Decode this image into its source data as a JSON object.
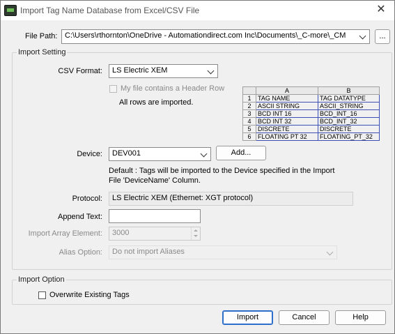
{
  "window": {
    "title": "Import Tag Name Database from Excel/CSV File",
    "close_glyph": "✕"
  },
  "file_path": {
    "label": "File Path:",
    "value": "C:\\Users\\rthornton\\OneDrive - Automationdirect.com Inc\\Documents\\_C-more\\_CM",
    "browse_label": "..."
  },
  "import_setting": {
    "title": "Import Setting",
    "csv_format_label": "CSV Format:",
    "csv_format_value": "LS Electric XEM",
    "header_row_label": "My file contains a Header Row",
    "header_row_checked": false,
    "rows_note": "All rows are imported.",
    "preview": {
      "col_headers": [
        "A",
        "B"
      ],
      "rows": [
        {
          "num": "1",
          "a": "TAG NAME",
          "b": "TAG DATATYPE"
        },
        {
          "num": "2",
          "a": "ASCII STRING",
          "b": "ASCII_STRING"
        },
        {
          "num": "3",
          "a": "BCD INT 16",
          "b": "BCD_INT_16"
        },
        {
          "num": "4",
          "a": "BCD INT 32",
          "b": "BCD_INT_32"
        },
        {
          "num": "5",
          "a": "DISCRETE",
          "b": "DISCRETE"
        },
        {
          "num": "6",
          "a": "FLOATING PT 32",
          "b": "FLOATING_PT_32"
        }
      ]
    },
    "device_label": "Device:",
    "device_value": "DEV001",
    "add_label": "Add...",
    "default_note_line1": "Default : Tags will be imported to the Device specified in the Import",
    "default_note_line2": "File 'DeviceName' Column.",
    "protocol_label": "Protocol:",
    "protocol_value": "LS Electric XEM (Ethernet: XGT protocol)",
    "append_text_label": "Append Text:",
    "append_text_value": "",
    "import_array_label": "Import Array Element:",
    "import_array_value": "3000",
    "alias_label": "Alias Option:",
    "alias_value": "Do not import Aliases"
  },
  "import_option": {
    "title": "Import Option",
    "overwrite_label": "Overwrite Existing Tags",
    "overwrite_checked": false
  },
  "buttons": {
    "import": "Import",
    "cancel": "Cancel",
    "help": "Help"
  }
}
